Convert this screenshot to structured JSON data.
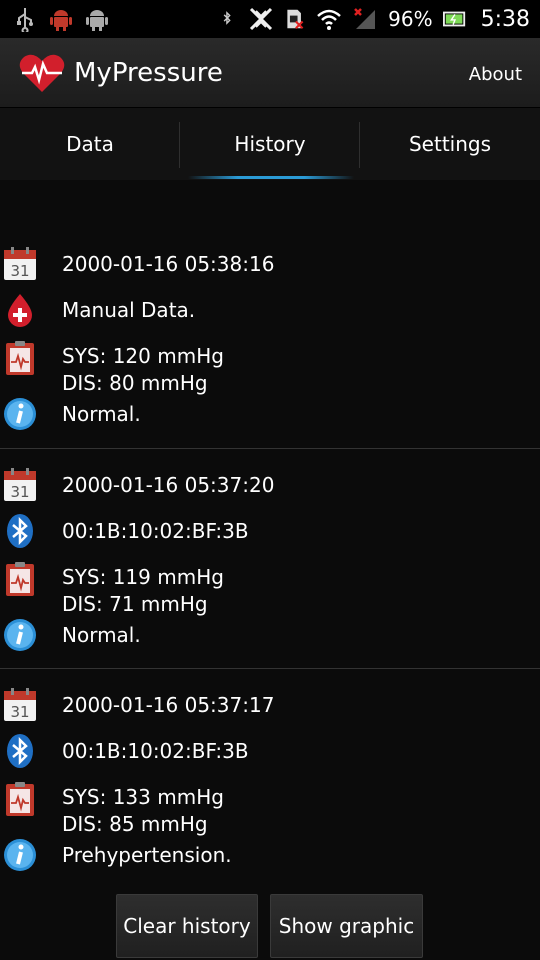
{
  "status_bar": {
    "battery": "96%",
    "time": "5:38",
    "left_icons": [
      "usb-icon",
      "android-debug-icon",
      "android-icon"
    ],
    "right_icons": [
      "bluetooth-icon",
      "nfc-off-icon",
      "sim-error-icon",
      "wifi-icon",
      "signal-no-service-icon",
      "battery-icon"
    ]
  },
  "app": {
    "title": "MyPressure",
    "about_label": "About",
    "accent": "#2b9bd6"
  },
  "tabs": [
    {
      "label": "Data"
    },
    {
      "label": "History"
    },
    {
      "label": "Settings"
    }
  ],
  "selected_tab": "History",
  "history": [
    {
      "date": "2000-01-16 05:38:16",
      "source_icon": "blood-drop-icon",
      "source": "Manual Data.",
      "sys": "SYS: 120 mmHg",
      "dis": "DIS: 80 mmHg",
      "status": "Normal."
    },
    {
      "date": "2000-01-16 05:37:20",
      "source_icon": "bluetooth-icon",
      "source": "00:1B:10:02:BF:3B",
      "sys": "SYS: 119 mmHg",
      "dis": "DIS: 71 mmHg",
      "status": "Normal."
    },
    {
      "date": "2000-01-16 05:37:17",
      "source_icon": "bluetooth-icon",
      "source": "00:1B:10:02:BF:3B",
      "sys": "SYS: 133 mmHg",
      "dis": "DIS: 85 mmHg",
      "status": "Prehypertension."
    }
  ],
  "calendar_icon_day": "31",
  "buttons": {
    "clear": "Clear history",
    "graph": "Show graphic"
  }
}
